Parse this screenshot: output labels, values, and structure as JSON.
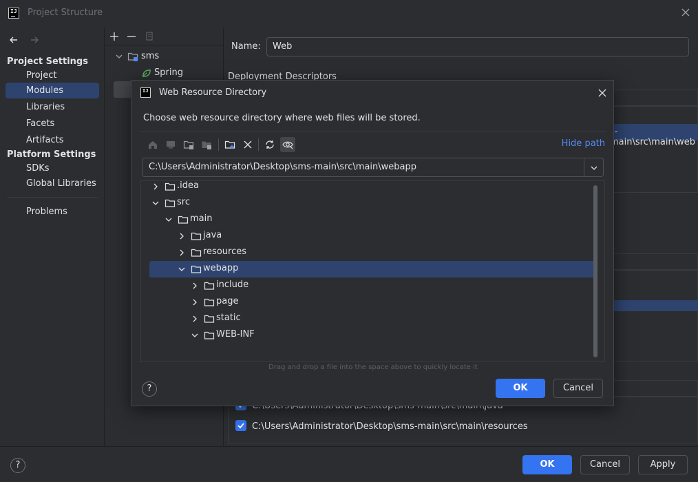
{
  "window": {
    "title": "Project Structure"
  },
  "left_nav": {
    "project_settings_header": "Project Settings",
    "project_items": [
      "Project",
      "Modules",
      "Libraries",
      "Facets",
      "Artifacts"
    ],
    "selected": "Modules",
    "platform_settings_header": "Platform Settings",
    "platform_items": [
      "SDKs",
      "Global Libraries"
    ],
    "problems": "Problems"
  },
  "module_tree": {
    "root": "sms",
    "child": "Spring"
  },
  "module_panel": {
    "name_label": "Name:",
    "name_value": "Web",
    "deployment_descriptors_label": "Deployment Descriptors",
    "bg_path_fragment": "s-main\\src\\main\\web",
    "source_roots": [
      "C:\\Users\\Administrator\\Desktop\\sms-main\\src\\main\\java",
      "C:\\Users\\Administrator\\Desktop\\sms-main\\src\\main\\resources"
    ]
  },
  "dialog": {
    "title": "Web Resource Directory",
    "description": "Choose web resource directory where web files will be stored.",
    "hide_path": "Hide path",
    "path": "C:\\Users\\Administrator\\Desktop\\sms-main\\src\\main\\webapp",
    "tree": [
      {
        "label": ".idea",
        "expanded": false
      },
      {
        "label": "src",
        "expanded": true
      },
      {
        "label": "main",
        "expanded": true
      },
      {
        "label": "java",
        "expanded": false
      },
      {
        "label": "resources",
        "expanded": false
      },
      {
        "label": "webapp",
        "expanded": true,
        "selected": true
      },
      {
        "label": "include",
        "expanded": false
      },
      {
        "label": "page",
        "expanded": false
      },
      {
        "label": "static",
        "expanded": false
      },
      {
        "label": "WEB-INF",
        "expanded": true
      }
    ],
    "hint": "Drag and drop a file into the space above to quickly locate it",
    "ok": "OK",
    "cancel": "Cancel",
    "help": "?"
  },
  "footer": {
    "ok": "OK",
    "cancel": "Cancel",
    "apply": "Apply",
    "help": "?"
  },
  "colors": {
    "accent": "#3574f0",
    "selection": "#2e436e",
    "link": "#548af7",
    "background": "#2b2d30"
  }
}
